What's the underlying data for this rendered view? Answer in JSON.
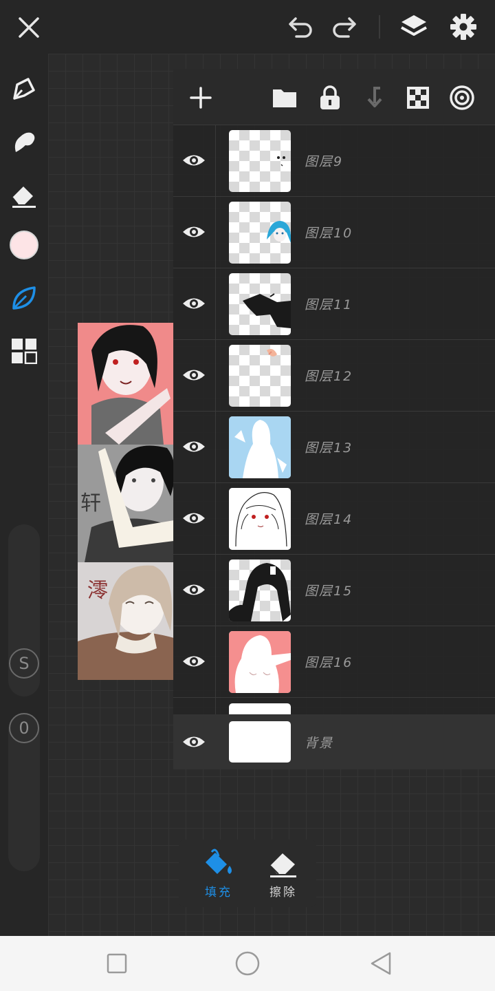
{
  "toolbar": {
    "close": "close-icon",
    "undo": "undo-icon",
    "redo": "redo-icon",
    "layers": "layers-icon",
    "settings": "gear-icon"
  },
  "side_tools": {
    "color_swatch": "#fde4e6",
    "active_color": "#1e8fe6",
    "size_slider_label": "S",
    "opacity_slider_label": "0"
  },
  "layers_panel": {
    "layers": [
      {
        "name": "图层9"
      },
      {
        "name": "图层10"
      },
      {
        "name": "图层11"
      },
      {
        "name": "图层12"
      },
      {
        "name": "图层13"
      },
      {
        "name": "图层14"
      },
      {
        "name": "图层15"
      },
      {
        "name": "图层16"
      }
    ],
    "background": {
      "name": "背景"
    }
  },
  "actions": {
    "fill_label": "填充",
    "erase_label": "擦除"
  },
  "artwork_text": {
    "char1": "轩",
    "char2": "澪"
  }
}
